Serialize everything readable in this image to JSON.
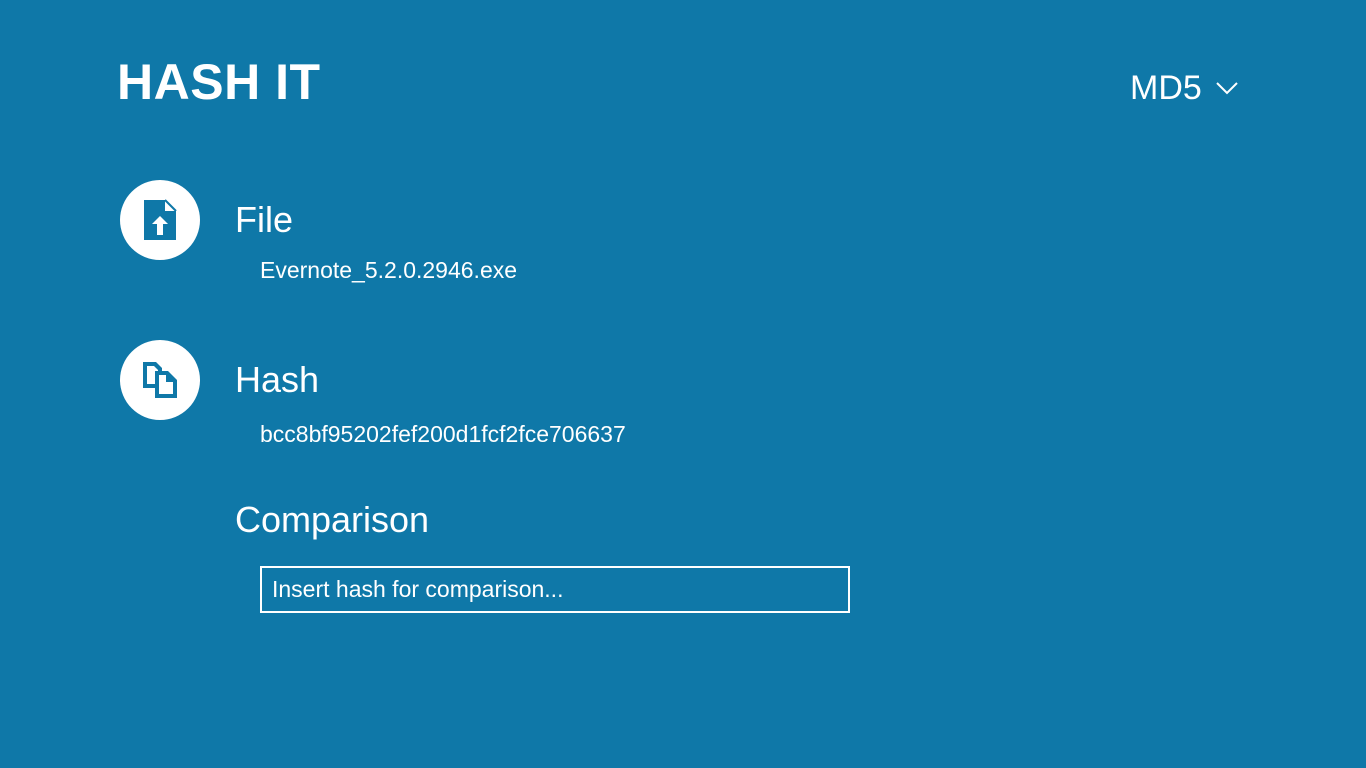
{
  "app": {
    "title": "HASH IT"
  },
  "algorithm": {
    "selected": "MD5",
    "icon": "chevron-down-icon"
  },
  "file": {
    "title": "File",
    "value": "Evernote_5.2.0.2946.exe",
    "icon": "file-upload-icon"
  },
  "hash": {
    "title": "Hash",
    "value": "bcc8bf95202fef200d1fcf2fce706637",
    "icon": "copy-icon"
  },
  "comparison": {
    "title": "Comparison",
    "placeholder": "Insert hash for comparison..."
  },
  "colors": {
    "background": "#0f78a8",
    "foreground": "#ffffff"
  }
}
